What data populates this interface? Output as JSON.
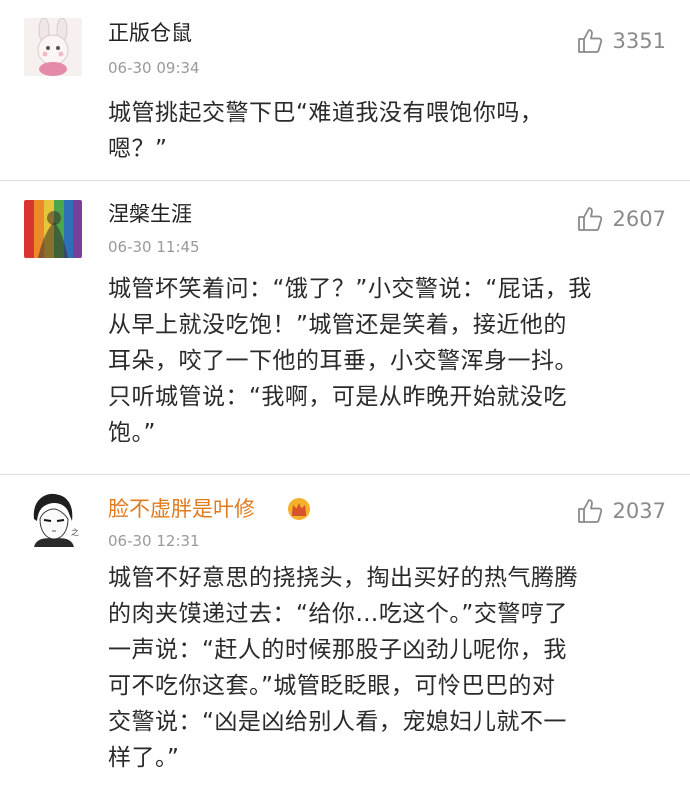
{
  "comments": [
    {
      "username": "正版仓鼠",
      "time": "06-30 09:34",
      "likes": "3351",
      "lines": [
        "城管挑起交警下巴“难道我没有喂饱你吗，",
        "嗯？”"
      ]
    },
    {
      "username": "涅槃生涯",
      "time": "06-30 11:45",
      "likes": "2607",
      "lines": [
        "城管坏笑着问：“饿了？”小交警说：“屁话，我",
        "从早上就没吃饱！”城管还是笑着，接近他的",
        "耳朵，咬了一下他的耳垂，小交警浑身一抖。",
        "只听城管说：“我啊，可是从昨晚开始就没吃",
        "饱。”"
      ]
    },
    {
      "username": "脸不虚胖是叶修",
      "time": "06-30 12:31",
      "likes": "2037",
      "vip": "crown-badge-icon",
      "lines": [
        "城管不好意思的挠挠头，掏出买好的热气腾腾",
        "的肉夹馍递过去：“给你…吃这个。”交警哼了",
        "一声说：“赶人的时候那股子凶劲儿呢你，我",
        "可不吃你这套。”城管眨眨眼，可怜巴巴的对",
        "交警说：“凶是凶给别人看，宠媳妇儿就不一",
        "样了。”"
      ]
    }
  ],
  "colors": {
    "vip_name": "#e07b1f",
    "divider": "#dcdcdc",
    "meta": "#9a9a9a"
  }
}
